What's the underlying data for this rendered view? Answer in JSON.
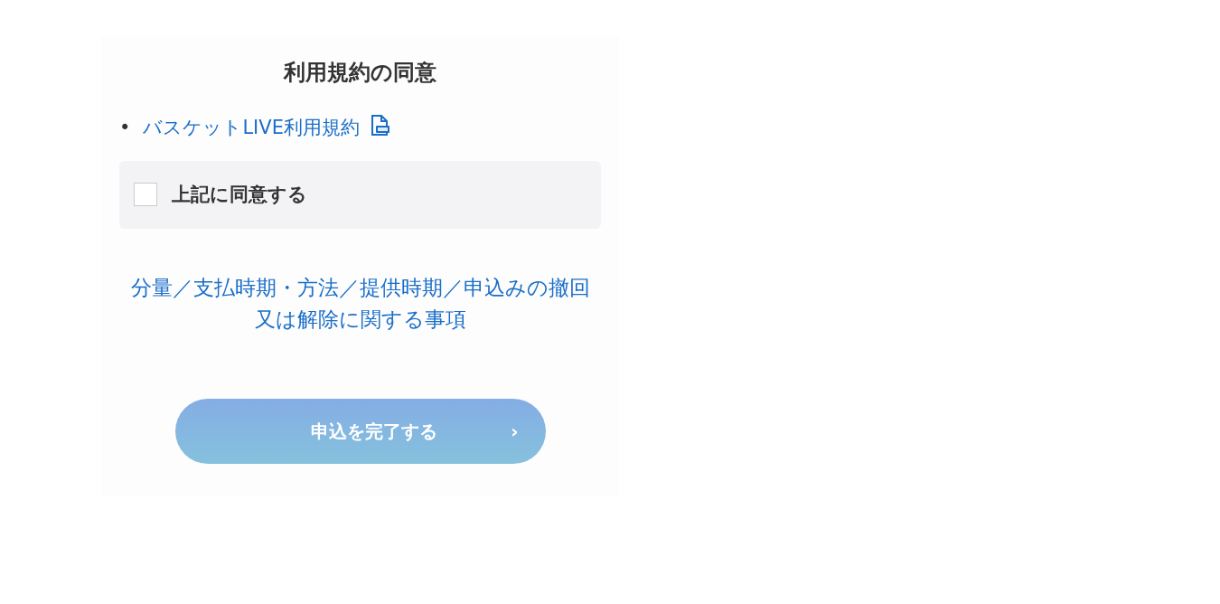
{
  "title": "利用規約の同意",
  "documents": [
    {
      "marker": "•",
      "label": "バスケットLIVE利用規約",
      "kind": "pdf"
    }
  ],
  "agreement": {
    "label": "上記に同意する",
    "checked": false
  },
  "info_link": "分量／支払時期・方法／提供時期／申込みの撤回又は解除に関する事項",
  "submit": {
    "label": "申込を完了する",
    "icon": "›",
    "disabled": true
  }
}
